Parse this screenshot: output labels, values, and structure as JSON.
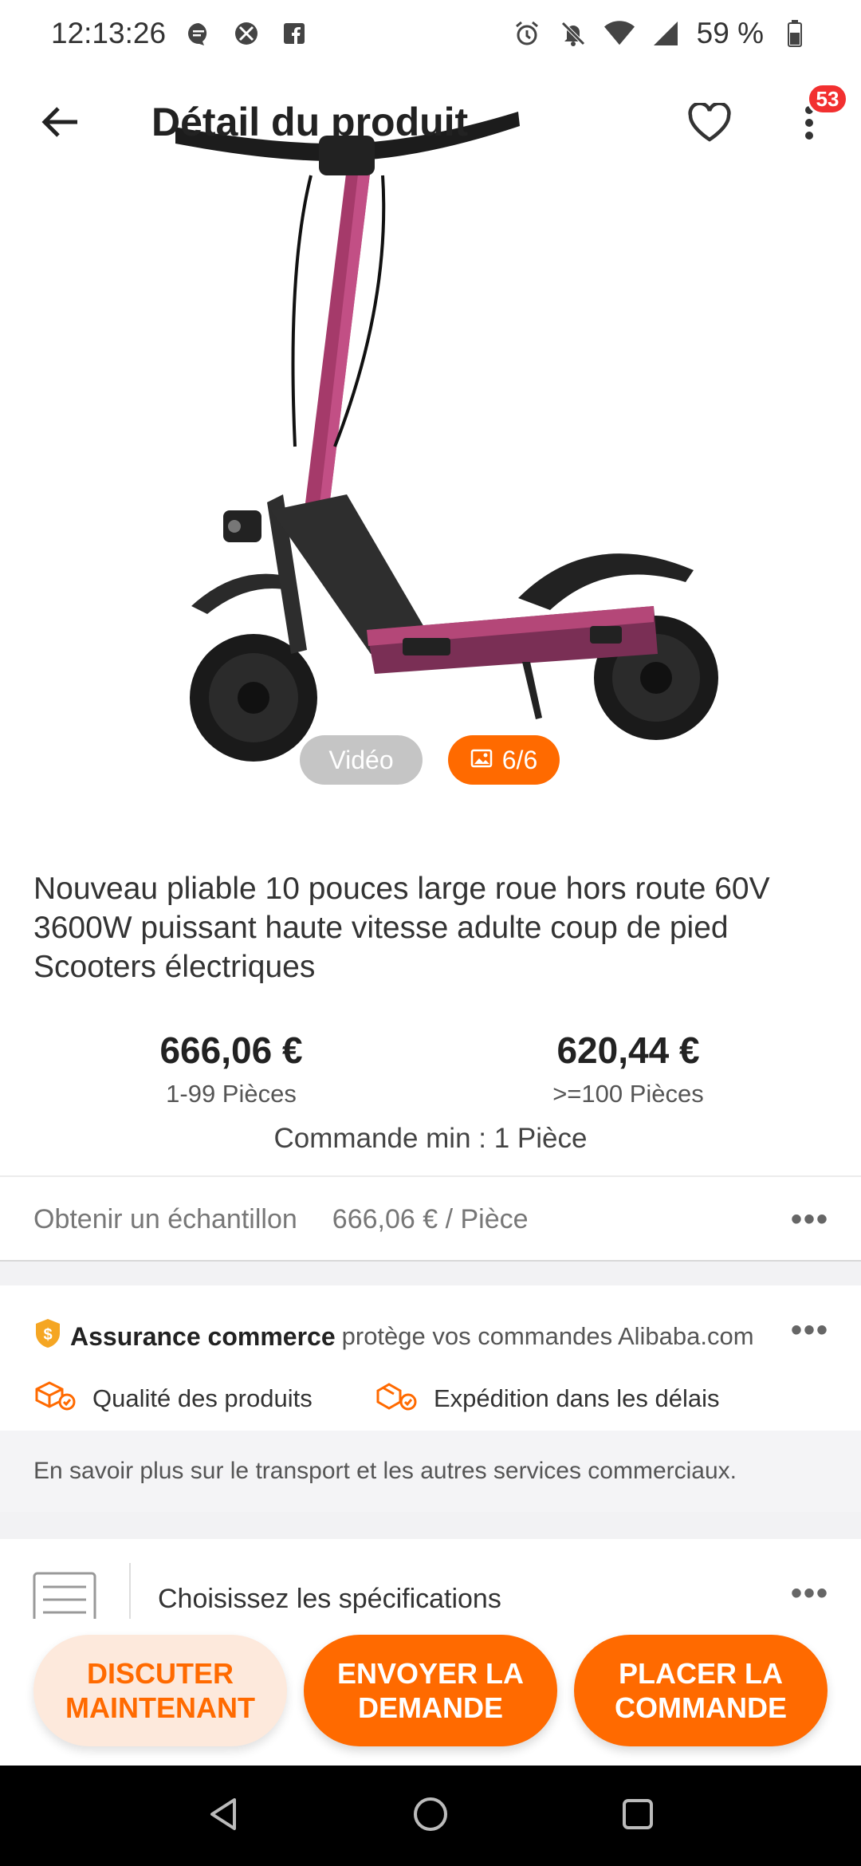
{
  "status_bar": {
    "time": "12:13:26",
    "battery": "59 %",
    "icons_left": [
      "message-icon",
      "xbox-icon",
      "facebook-icon"
    ],
    "icons_right": [
      "alarm-icon",
      "mute-icon",
      "wifi-icon",
      "signal-icon",
      "battery-icon"
    ]
  },
  "header": {
    "title": "Détail du produit",
    "back_icon": "arrow-left-icon",
    "favorite_icon": "heart-icon",
    "more_icon": "more-vertical-icon",
    "notification_count": "53"
  },
  "media": {
    "video_label": "Vidéo",
    "photo_counter": "6/6",
    "photo_icon": "image-icon"
  },
  "product": {
    "title": "Nouveau pliable 10 pouces large roue hors route 60V 3600W puissant haute vitesse adulte coup de pied Scooters électriques",
    "prices": [
      {
        "price": "666,06 €",
        "qty": "1-99 Pièces"
      },
      {
        "price": "620,44 €",
        "qty": ">=100 Pièces"
      }
    ],
    "min_order": "Commande min : 1 Pièce"
  },
  "sample": {
    "label": "Obtenir un échantillon",
    "price": "666,06 € / Pièce",
    "more": "•••"
  },
  "assurance": {
    "strong": "Assurance commerce",
    "text": "protège vos commandes Alibaba.com",
    "more": "•••",
    "features": [
      "Qualité des produits",
      "Expédition dans les délais"
    ]
  },
  "info_strip": {
    "text": "En savoir plus sur le transport et les autres services commerciaux."
  },
  "specs": {
    "label": "Choisissez les spécifications",
    "more": "•••"
  },
  "actions": {
    "chat": "DISCUTER MAINTENANT",
    "inquiry": "ENVOYER LA DEMANDE",
    "order": "PLACER LA COMMANDE"
  },
  "colors": {
    "accent": "#ff6a00",
    "badge": "#f23030",
    "chat_bg": "#fde9dc"
  }
}
